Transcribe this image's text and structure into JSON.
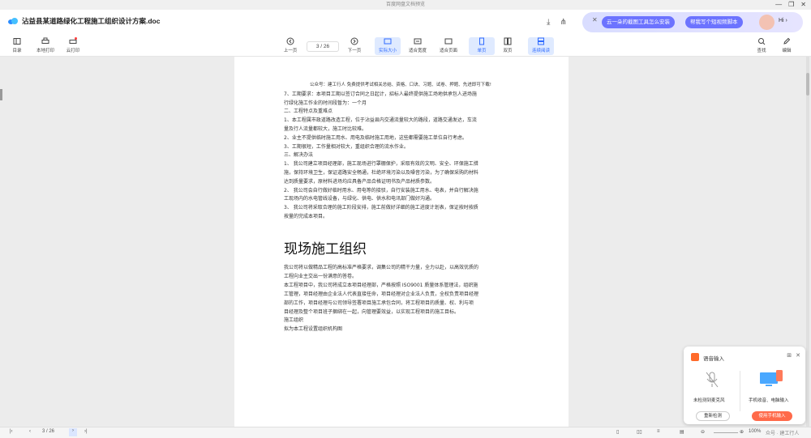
{
  "window": {
    "title": "百度网盘文档预览",
    "controls": [
      "—",
      "❐",
      "✕"
    ]
  },
  "header": {
    "file_name": "沾益县某道路绿化工程施工组织设计方案.doc",
    "download_icon": "download-icon",
    "share_icon": "share-icon"
  },
  "ai_bar": {
    "close": "✕",
    "chip1": "云一朵的截图工具怎么安装",
    "chip2": "帮我写个短视频脚本",
    "greeting": "Hi ›"
  },
  "toolbar": {
    "left": [
      {
        "label": "目录",
        "icon": "outline-icon"
      },
      {
        "label": "本地打印",
        "icon": "printer-icon"
      },
      {
        "label": "云打印",
        "icon": "cloud-printer-icon"
      }
    ],
    "prev": "上一页",
    "next": "下一页",
    "page_indicator": "3 / 26",
    "views": [
      {
        "label": "实际大小",
        "icon": "actual-size-icon",
        "active": true
      },
      {
        "label": "适合宽度",
        "icon": "fit-width-icon",
        "active": false
      },
      {
        "label": "适合页面",
        "icon": "fit-page-icon",
        "active": false
      },
      {
        "label": "单页",
        "icon": "single-page-icon",
        "active": true
      },
      {
        "label": "双页",
        "icon": "double-page-icon",
        "active": false
      },
      {
        "label": "连续阅读",
        "icon": "continuous-icon",
        "active": true
      }
    ],
    "right": [
      {
        "label": "查找",
        "icon": "search-icon"
      },
      {
        "label": "编辑",
        "icon": "edit-icon"
      }
    ]
  },
  "document": {
    "header_line": "公众号：建工行人 免费提供考试相关总结、资格、口诀、习题、试卷、押题、先进即可下载!",
    "lines": [
      "7、工期要求：本项目工期以签订合同之日起计，招标人最终提供施工场地供承包人进场施",
      "行绿化施工作业的时间段暂为：一个月",
      "二、工程特点及重难点",
      "1、本工程属市政道路改造工程，位于沾益县内交通流量较大的路段，道路交通发达，车流",
      "量及行人流量都较大，施工时比较难。",
      "2、业主不提供临时施工用水、用电及临时施工用地，这些都需要施工单位自行考虑。",
      "3、工期很短，工作量相对较大，重组织合理的流水作业。",
      "三、解决办法",
      "1、 我公司建立项目经理部，施工现场进行罩棚保护，采取有效的文明、安全、环保施工措",
      "施，保持环境卫生，保证道路安全畅通，杜绝环境污染以及噪音污染，为了确保采购的材料",
      "达到质量要求，原材料进场均应具备产品合格证明书及产品材质参数。",
      "2、 我公司会自行做好临时用水、用电等的接驳，自行安装施工用水、电表，并自行解决施",
      "工现场内的水电管线设备，与绿化、供电、供水和电讯部门做好沟通。",
      "3、 我公司将采取合理的施工阶段安排，施工前做好详细的施工进度计划表，保证按时按质",
      "按量的完成本项目。"
    ],
    "section_title": "现场施工组织",
    "section_lines": [
      "我公司将以做精品工程的高标准严格要求，调集公司的精干力量，全力以赴，以高效优质的",
      "工程向业主交出一份满意的答卷。",
      "本工程项目中，我公司将成立本项目经理部，严格按照 ISO9001 质量体系管理法，组织施",
      "工管理，项目经理由企业法人代表直接任命，项目经理对企业法人负责，全权负责项目经理",
      "部的工作，项目经理与公司领导签署项目施工承包合同，将工程项目的质量、权、利与项",
      "目经理及整个项目班子捆绑在一起，向管理要效益，以实现工程项目的施工目标。",
      "施工组织",
      "拟为本工程设置组织机构图"
    ]
  },
  "statusbar": {
    "page": "3 / 26",
    "zoom": "100%",
    "watermark": "众号 · 建工行人"
  },
  "voice_panel": {
    "title": "语音输入",
    "no_mic": "未检测到麦克风",
    "phone_label": "手机收音、电脑输入",
    "retry": "重新检测",
    "use_phone": "使用手机输入"
  }
}
